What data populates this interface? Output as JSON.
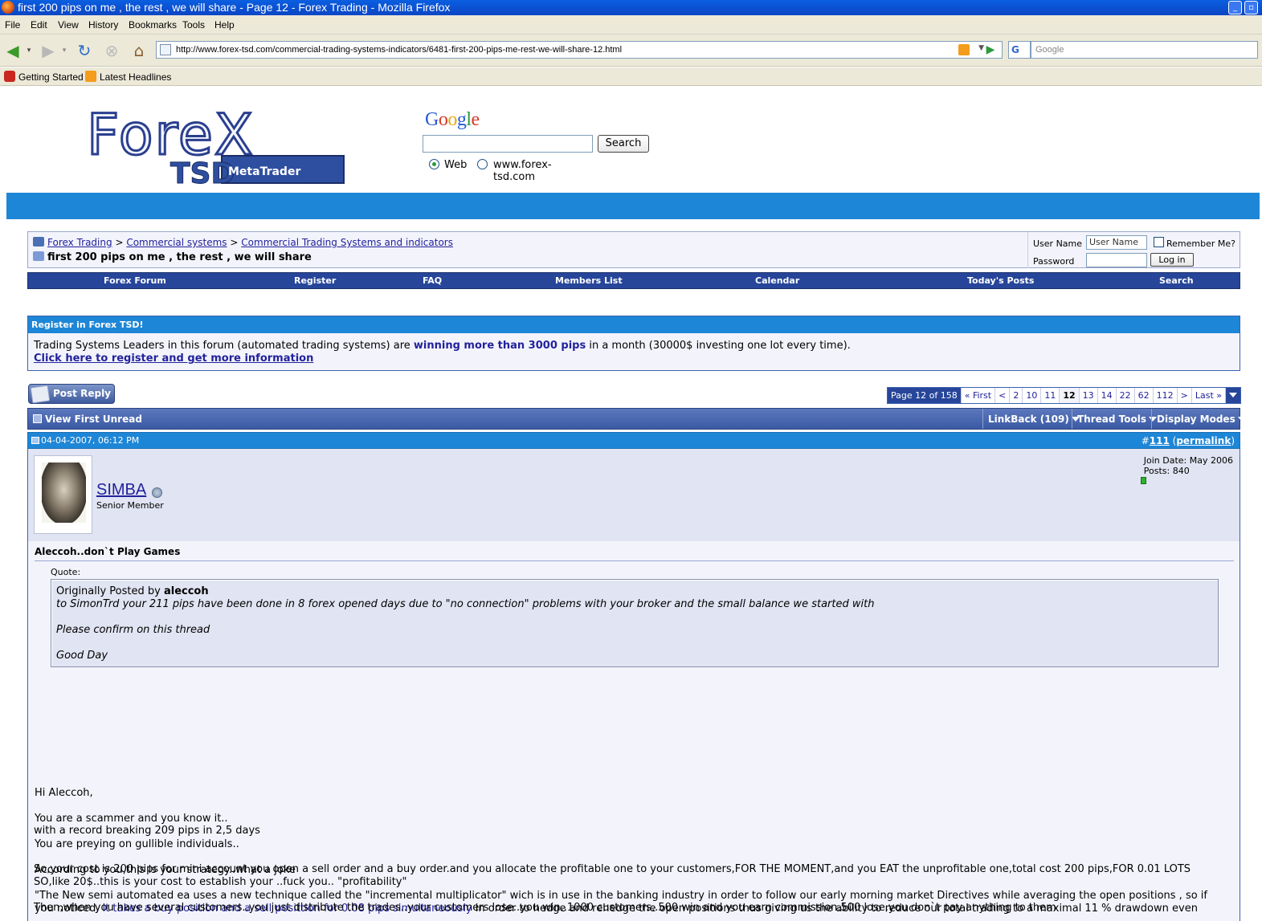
{
  "window": {
    "title": "first 200 pips on me , the rest , we will share - Page 12 - Forex Trading - Mozilla Firefox"
  },
  "menubar": [
    "File",
    "Edit",
    "View",
    "History",
    "Bookmarks",
    "Tools",
    "Help"
  ],
  "toolbar": {
    "url": "http://www.forex-tsd.com/commercial-trading-systems-indicators/6481-first-200-pips-me-rest-we-will-share-12.html",
    "search_engine": "G",
    "search_placeholder": "Google"
  },
  "bookmarks": [
    "Getting Started",
    "Latest Headlines"
  ],
  "header": {
    "logo_text": "ForeX",
    "logo_sub": "TSD",
    "logo_badge": "MetaTrader",
    "google_logo": "Google",
    "search_button": "Search",
    "radio_web": "Web",
    "radio_site": "www.forex-tsd.com"
  },
  "breadcrumb": {
    "links": [
      "Forex Trading",
      "Commercial systems",
      "Commercial Trading Systems and indicators"
    ],
    "separator": ">",
    "current": "first 200 pips on me , the rest , we will share"
  },
  "login": {
    "username_label": "User Name",
    "username_value": "User Name",
    "password_label": "Password",
    "remember_label": "Remember Me?",
    "login_button": "Log in"
  },
  "navstrip": [
    "Forex Forum",
    "Register",
    "FAQ",
    "Members List",
    "Calendar",
    "Today's Posts",
    "Search"
  ],
  "register": {
    "header": "Register in Forex TSD!",
    "text_before": "Trading Systems Leaders in this forum (automated trading systems) are ",
    "text_bold": "winning more than 3000 pips",
    "text_after": " in a month (30000$ investing one lot every time).",
    "link": "Click here to register and get more information"
  },
  "post_reply": "Post Reply",
  "pager": {
    "label": "Page 12 of 158",
    "first": "« First",
    "prev": "<",
    "pages": [
      "2",
      "10",
      "11",
      "12",
      "13",
      "14",
      "22",
      "62",
      "112"
    ],
    "current": "12",
    "next": ">",
    "last": "Last »"
  },
  "threadbar": {
    "view_first_unread": "View First Unread",
    "linkback": "LinkBack (109)",
    "thread_tools": "Thread Tools",
    "display_modes": "Display Modes"
  },
  "post": {
    "date": "04-04-2007, 06:12 PM",
    "number_prefix": "#",
    "number": "111",
    "permalink": "permalink",
    "username": "SIMBA",
    "user_title": "Senior Member",
    "join_date": "Join Date: May 2006",
    "posts": "Posts: 840",
    "title": "Aleccoh..don`t Play Games",
    "quote_label": "Quote:",
    "quote_by_prefix": "Originally Posted by ",
    "quote_author": "aleccoh",
    "quote_lines": [
      "to SimonTrd your 211 pips have been done in 8 forex opened days due to \"no connection\" problems with your broker and the small balance we started with",
      "Please confirm on this thread",
      "Good Day"
    ],
    "body": {
      "l1": "Hi Aleccoh,",
      "l2": "You are a scammer and you know it..",
      "l3": "You are preying on gullible individuals..",
      "l4": "According to you,this is your strategy..what a joke",
      "l5": "\"The New semi automated ea uses a new technique called the \"incremental multiplicator\" wich is in use in the banking industry in order to follow our early morning market Directives while averaging the open positions , so if",
      "l6a": "you noticed, ",
      "l6b": "it takes a buy position and a sell posittion for 0.08 pips simultaneously",
      "l6c": " in order to hedge and rehedge the open positions thus giving us the ability to reduce our total trading to a maximal 11 % drawdown even",
      "l7": "with a record breaking 209 pips in 2,5 days",
      "l8": "So,your cost is 200 pips for mini account you open a sell order and a buy order.and you allocate the profitable one to your customers,FOR THE MOMENT,and you EAT the unprofitable one,total cost 200 pips,FOR 0.01 LOTS",
      "l9": "SO,like 20$..this is your cost to establish your ..fuck you.. \"profitability\"",
      "l10": "Then,when you have several customers..you just distribute the trades..your customers lose..you win..1000 customers..500 win and you earn commission.500 lose,you don`t pay anything to them"
    }
  },
  "colors": {
    "titlebar": "#0b4fd0",
    "band": "#1e86d6",
    "nav": "#27469a",
    "link": "#22229c"
  }
}
